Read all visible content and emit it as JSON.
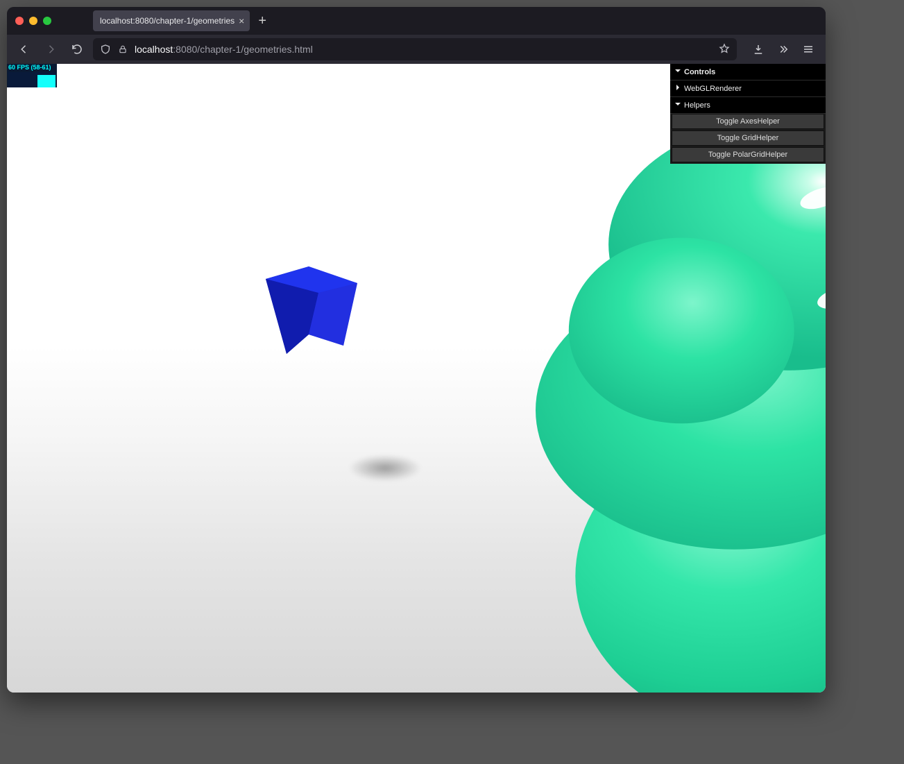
{
  "os": {
    "close": "",
    "min": "",
    "max": ""
  },
  "tab": {
    "title": "localhost:8080/chapter-1/geometries"
  },
  "url": {
    "host": "localhost",
    "port_path": ":8080/chapter-1/geometries.html"
  },
  "stats": {
    "text": "60 FPS (58-61)"
  },
  "gui": {
    "controls_label": "Controls",
    "renderer_label": "WebGLRenderer",
    "helpers_label": "Helpers",
    "buttons": {
      "axes": "Toggle AxesHelper",
      "grid": "Toggle GridHelper",
      "polar": "Toggle PolarGridHelper"
    }
  },
  "scene": {
    "cube_color": "#1522c8",
    "torus_color": "#29e2a2"
  }
}
